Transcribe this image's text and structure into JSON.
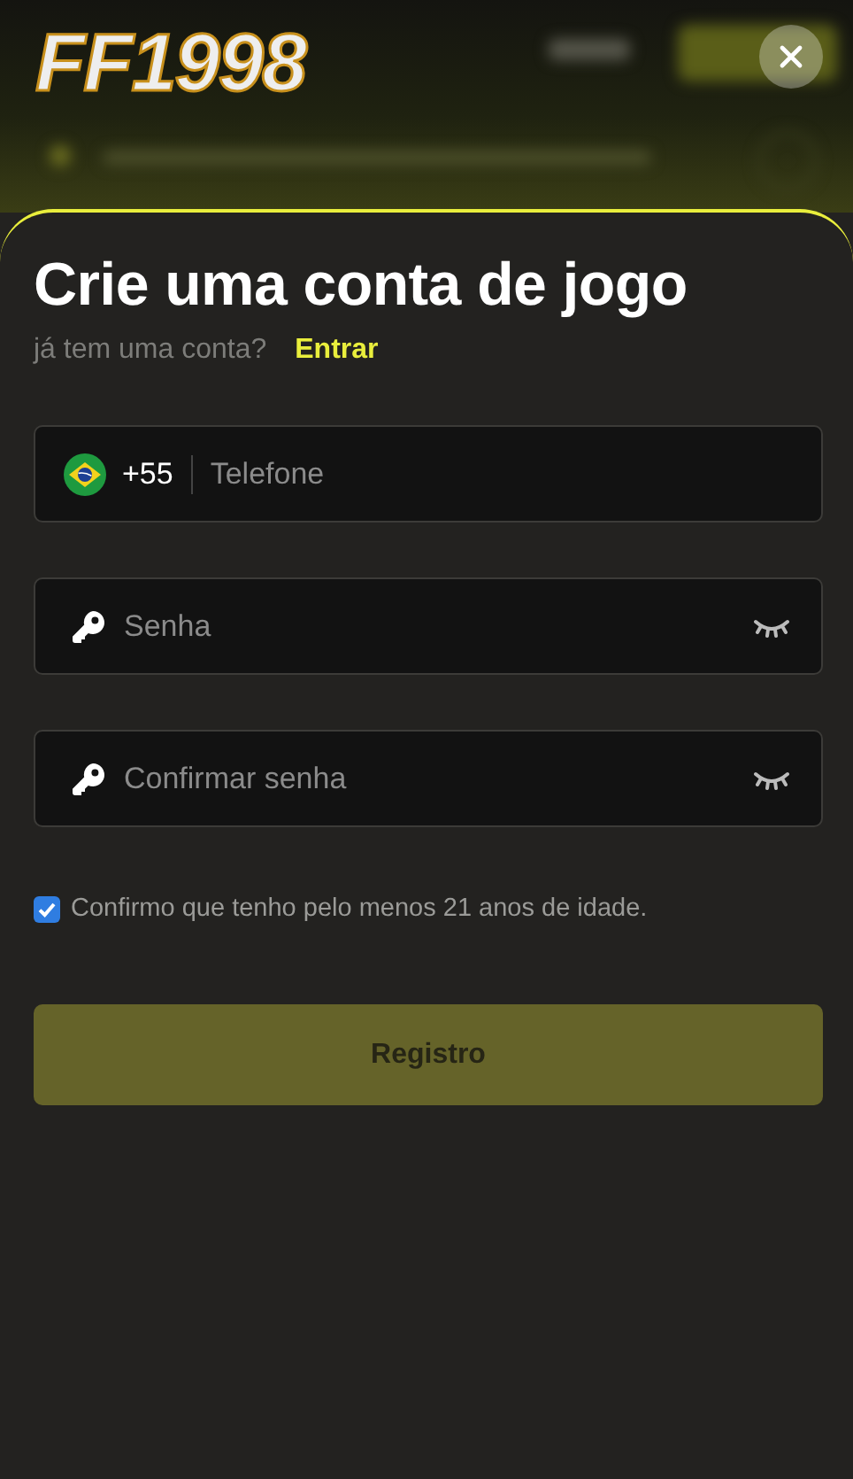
{
  "header": {
    "logo": "FF1998"
  },
  "dialog": {
    "title": "Crie uma conta de jogo",
    "subtitle": "já tem uma conta?",
    "login_link": "Entrar",
    "fields": [
      {
        "kind": "phone",
        "country_code": "+55",
        "placeholder": "Telefone"
      },
      {
        "kind": "password",
        "placeholder": "Senha"
      },
      {
        "kind": "password",
        "placeholder": "Confirmar senha"
      }
    ],
    "age_check": {
      "label": "Confirmo que tenho pelo menos 21 anos de idade.",
      "checked": true
    },
    "submit": {
      "label": "Registro",
      "disabled": true
    }
  }
}
